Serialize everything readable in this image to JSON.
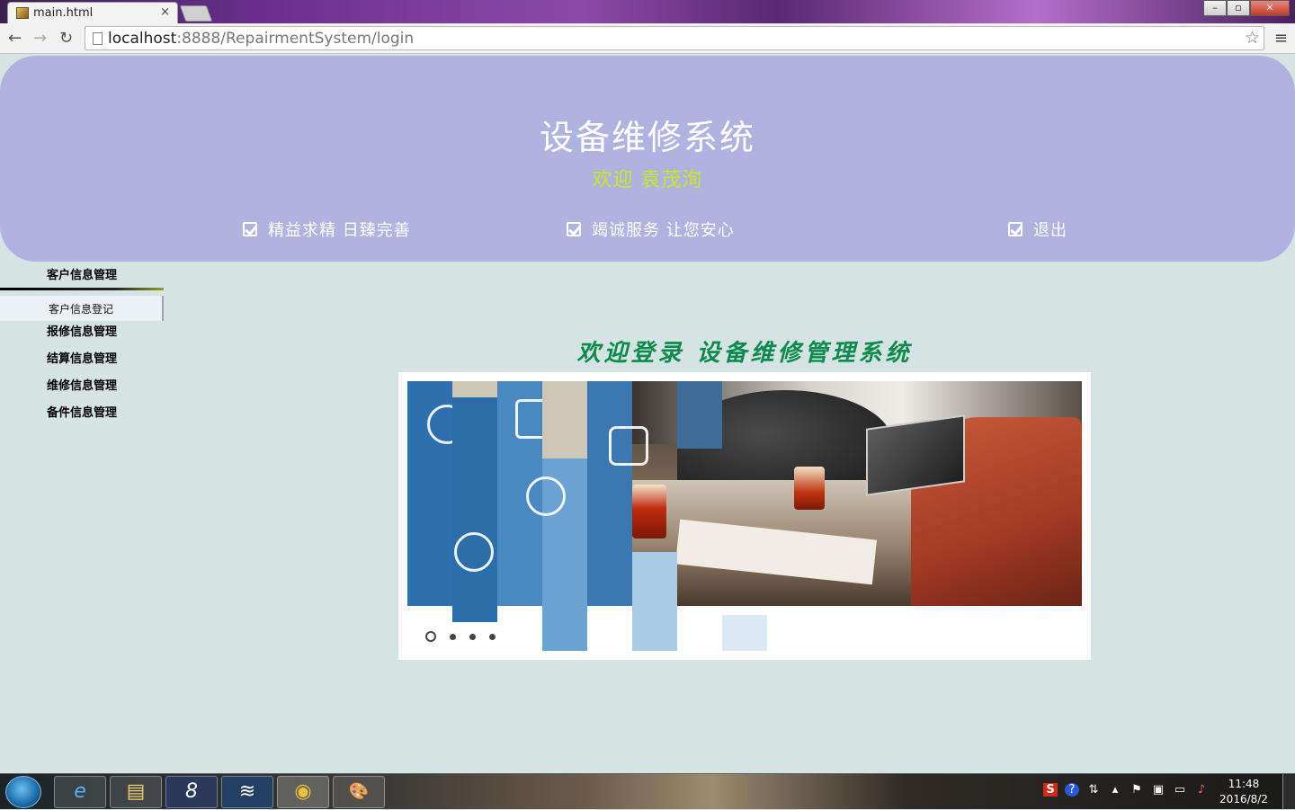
{
  "browser": {
    "tab_title": "main.html",
    "tab_close": "×",
    "url_host": "localhost",
    "url_path": ":8888/RepairmentSystem/login",
    "back": "←",
    "forward": "→",
    "reload": "↻",
    "star": "☆",
    "menu": "≡",
    "window_minimize": "–",
    "window_maximize": "▫",
    "window_close": "✕"
  },
  "header": {
    "title": "设备维修系统",
    "welcome": "欢迎  袁茂洵",
    "links": [
      {
        "label": "精益求精  日臻完善"
      },
      {
        "label": "竭诚服务  让您安心"
      },
      {
        "label": "退出"
      }
    ]
  },
  "sidebar": {
    "items": [
      {
        "label": "客户信息管理"
      },
      {
        "label": "报修信息管理"
      },
      {
        "label": "结算信息管理"
      },
      {
        "label": "维修信息管理"
      },
      {
        "label": "备件信息管理"
      }
    ],
    "submenu": [
      {
        "label": "客户信息登记"
      }
    ]
  },
  "main": {
    "heading": "欢迎登录 设备维修管理系统",
    "slider": {
      "dot_count": 4,
      "active_index": 0
    }
  },
  "taskbar": {
    "apps": [
      "internet-explorer",
      "file-explorer",
      "app-8",
      "mysql-workbench",
      "chrome",
      "paint"
    ],
    "app_glyphs": [
      "e",
      "▤",
      "8",
      "≋",
      "◉",
      "🎨"
    ],
    "tray_icons": [
      "sogou-input",
      "help",
      "network-arrows",
      "show-hidden",
      "flag",
      "device",
      "monitor",
      "volume-muted"
    ],
    "clock_time": "11:48",
    "clock_date": "2016/8/2"
  },
  "colors": {
    "header_bg": "#b0b2e0",
    "page_bg": "#d6e3e3",
    "welcome_text": "#c8e82a",
    "heading_text": "#0a8a4e"
  }
}
